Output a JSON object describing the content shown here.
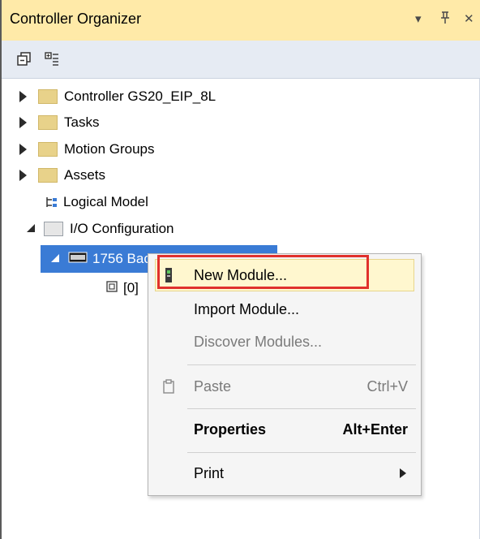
{
  "panel": {
    "title": "Controller Organizer",
    "pin_glyph": "ꟼ",
    "close_glyph": "✕",
    "dropdown_glyph": "▾"
  },
  "tree": {
    "items": [
      {
        "label": "Controller GS20_EIP_8L",
        "icon": "folder-icon"
      },
      {
        "label": "Tasks",
        "icon": "folder-icon"
      },
      {
        "label": "Motion Groups",
        "icon": "folder-icon"
      },
      {
        "label": "Assets",
        "icon": "folder-icon"
      },
      {
        "label": "Logical Model",
        "icon": "logical-model-icon"
      },
      {
        "label": "I/O Configuration",
        "icon": "folder-open-icon"
      },
      {
        "label": "1756 Backplane, 1756-A7",
        "icon": "backplane-icon"
      },
      {
        "label": "[0]",
        "icon": "module-icon"
      }
    ]
  },
  "context_menu": {
    "items": [
      {
        "label": "New Module...",
        "shortcut": "",
        "highlighted": true
      },
      {
        "label": "Import Module...",
        "shortcut": ""
      },
      {
        "label": "Discover Modules...",
        "shortcut": "",
        "disabled": true
      },
      {
        "label": "Paste",
        "shortcut": "Ctrl+V",
        "disabled": true
      },
      {
        "label": "Properties",
        "shortcut": "Alt+Enter",
        "bold": true
      },
      {
        "label": "Print",
        "shortcut": "",
        "submenu": true
      }
    ]
  },
  "colors": {
    "title_bar": "#ffeaa8",
    "toolbar": "#e6ebf3",
    "selection": "#3a7bd5",
    "menu_highlight": "#fff7cf",
    "annotation_box": "#e0312d"
  }
}
